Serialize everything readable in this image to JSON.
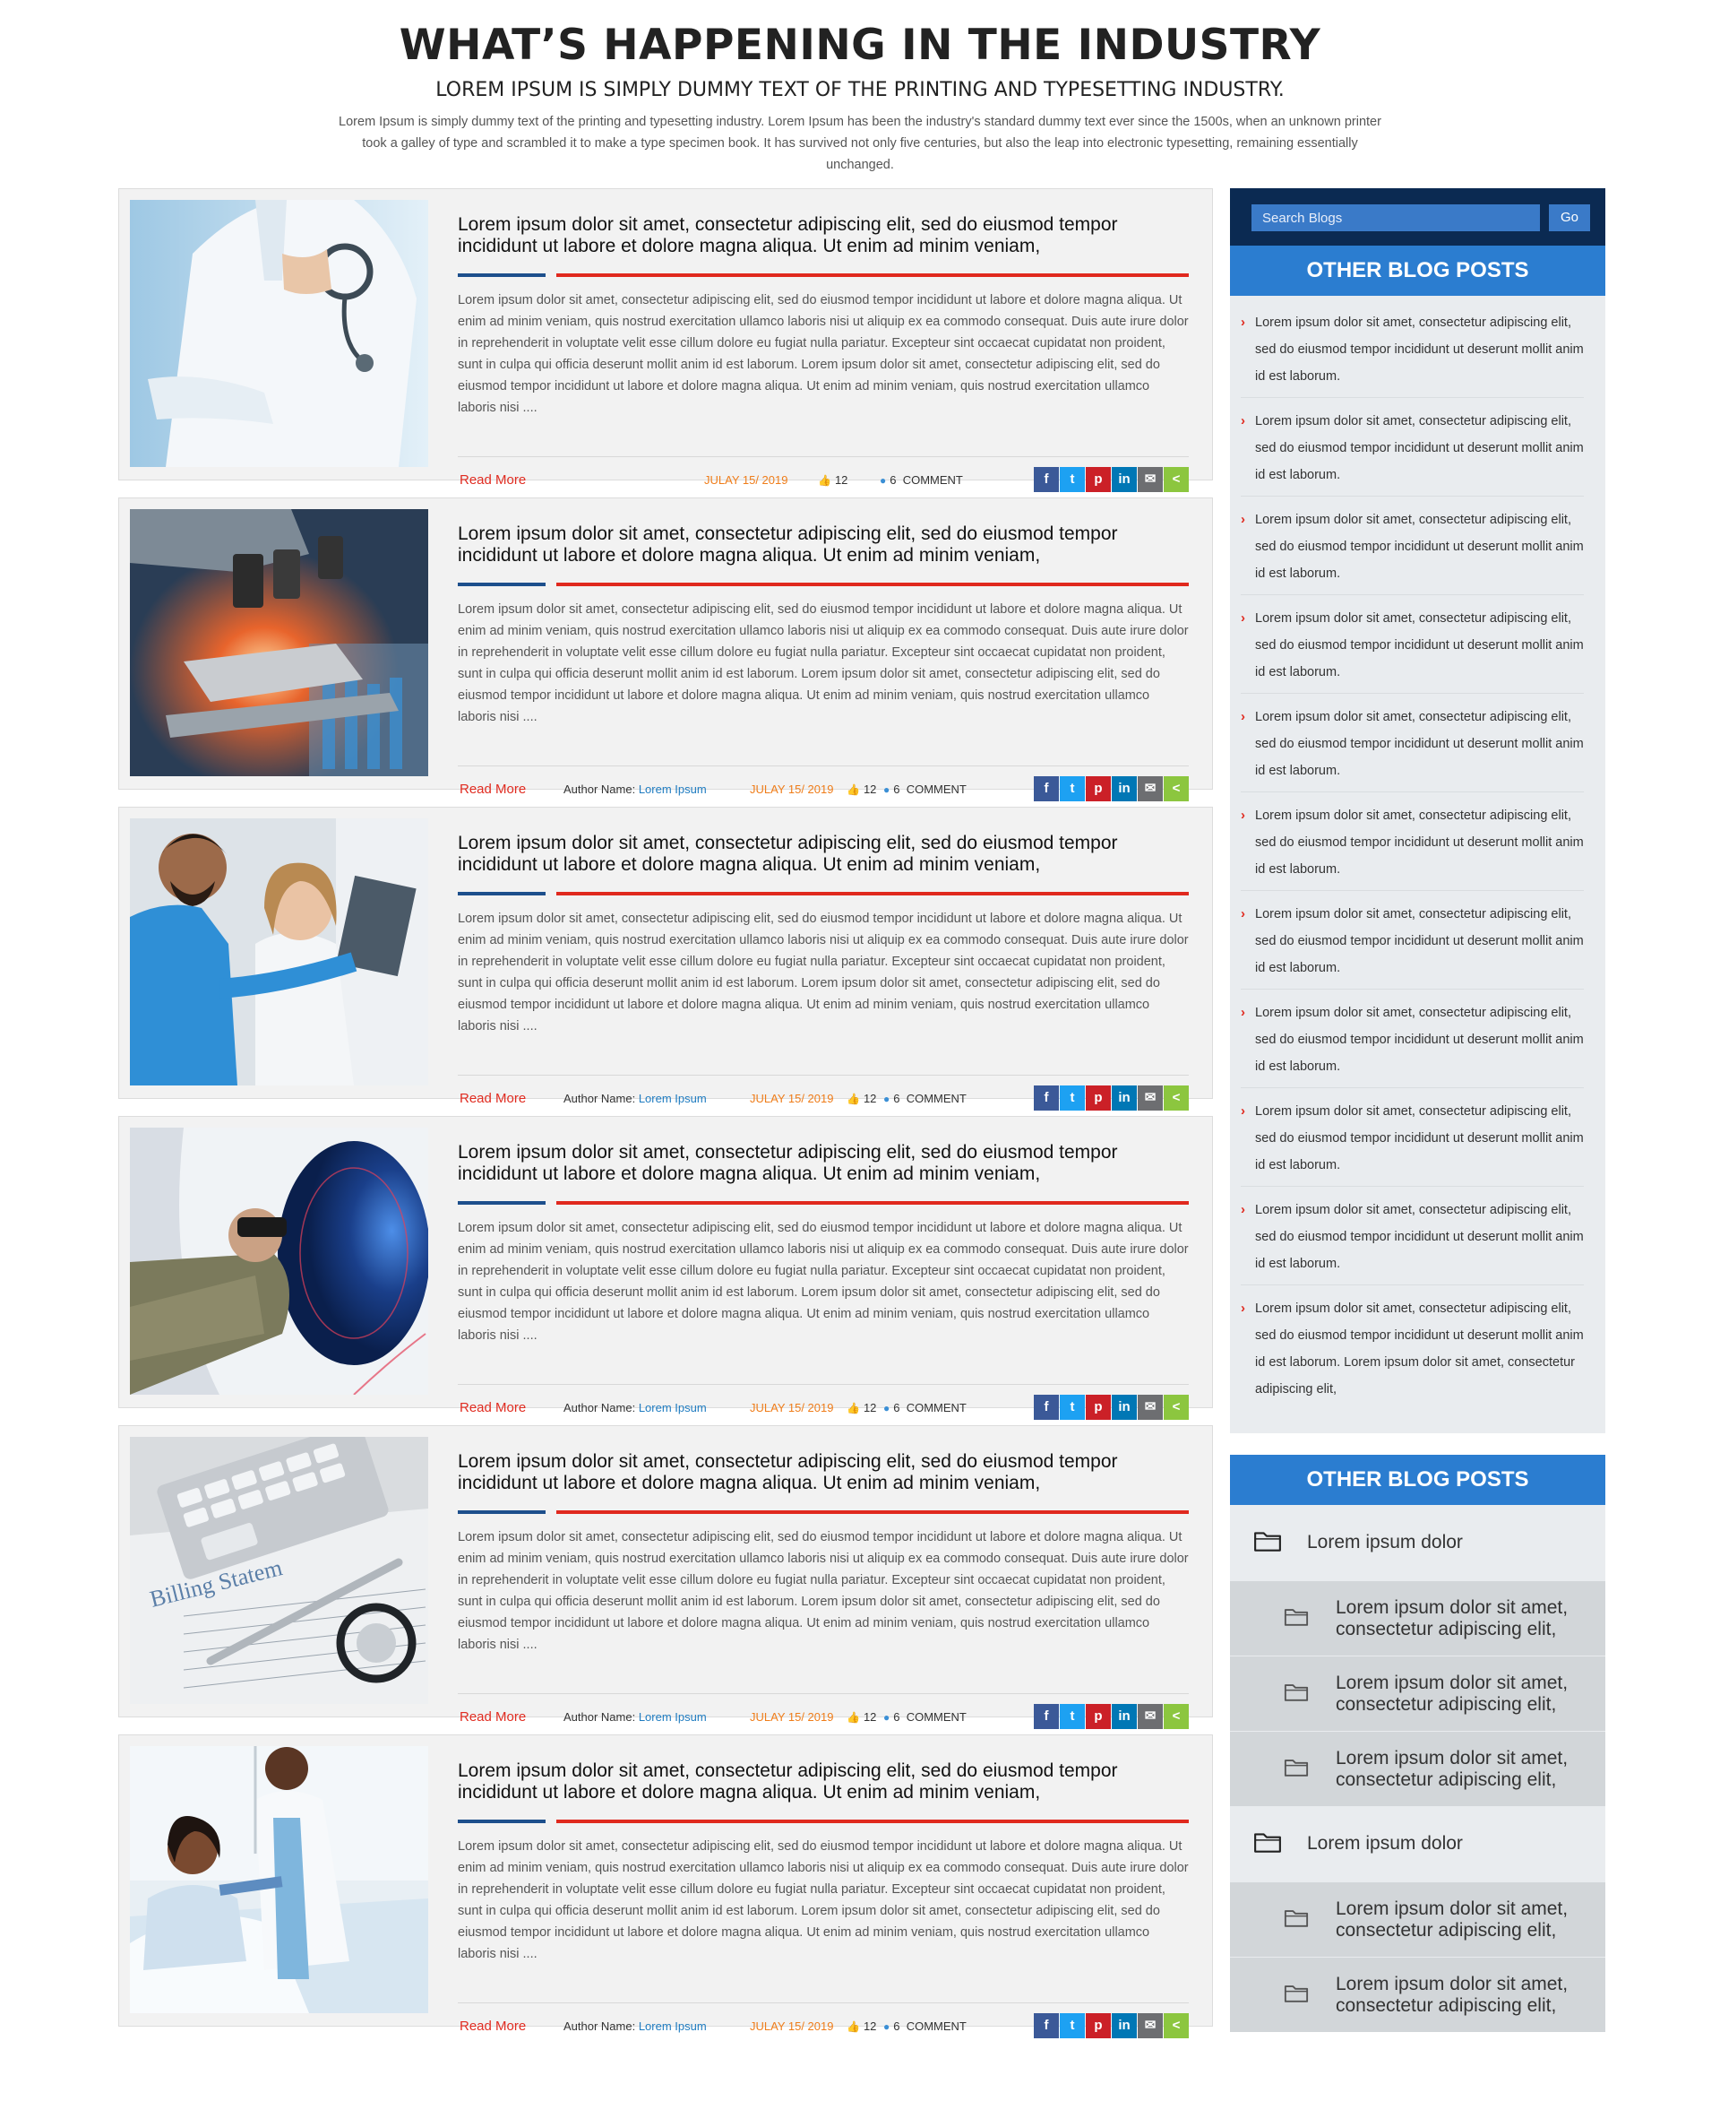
{
  "header": {
    "title": "WHAT’S HAPPENING IN THE INDUSTRY",
    "subtitle": "LOREM IPSUM IS SIMPLY DUMMY TEXT OF THE PRINTING AND TYPESETTING INDUSTRY.",
    "intro": "Lorem Ipsum is simply dummy text of the printing and typesetting industry. Lorem Ipsum has been the industry's standard dummy text ever since the 1500s, when an unknown printer took a galley of type and scrambled it to make a type specimen book. It has survived not only five centuries, but also the leap into electronic typesetting, remaining essentially unchanged."
  },
  "posts": [
    {
      "image": "doctor-with-stethoscope",
      "title": "Lorem ipsum dolor sit amet, consectetur adipiscing elit, sed do eiusmod tempor incididunt ut labore et dolore magna aliqua. Ut enim ad minim veniam,",
      "excerpt": "Lorem ipsum dolor sit amet, consectetur adipiscing elit, sed do eiusmod tempor incididunt ut labore et dolore magna aliqua. Ut enim ad minim veniam, quis nostrud exercitation ullamco laboris nisi ut aliquip ex ea commodo consequat. Duis aute irure dolor in reprehenderit in voluptate velit esse cillum dolore eu fugiat nulla pariatur. Excepteur sint occaecat cupidatat non proident, sunt in culpa qui officia deserunt mollit anim id est laborum. Lorem ipsum dolor sit amet, consectetur adipiscing elit, sed do eiusmod tempor incididunt ut labore et dolore magna aliqua. Ut enim ad minim veniam, quis nostrud exercitation ullamco laboris nisi ....",
      "read_more": "Read More",
      "author_label": "",
      "author_name": "",
      "date": "JULAY 15/ 2019",
      "likes": "12",
      "comments": "6",
      "comments_label": "COMMENT"
    },
    {
      "image": "microscope-lab",
      "title": "Lorem ipsum dolor sit amet, consectetur adipiscing elit, sed do eiusmod tempor incididunt ut labore et dolore magna aliqua. Ut enim ad minim veniam,",
      "excerpt": "Lorem ipsum dolor sit amet, consectetur adipiscing elit, sed do eiusmod tempor incididunt ut labore et dolore magna aliqua. Ut enim ad minim veniam, quis nostrud exercitation ullamco laboris nisi ut aliquip ex ea commodo consequat. Duis aute irure dolor in reprehenderit in voluptate velit esse cillum dolore eu fugiat nulla pariatur. Excepteur sint occaecat cupidatat non proident, sunt in culpa qui officia deserunt mollit anim id est laborum. Lorem ipsum dolor sit amet, consectetur adipiscing elit, sed do eiusmod tempor incididunt ut labore et dolore magna aliqua. Ut enim ad minim veniam, quis nostrud exercitation ullamco laboris nisi ....",
      "read_more": "Read More",
      "author_label": "Author Name:",
      "author_name": "Lorem Ipsum",
      "date": "JULAY 15/ 2019",
      "likes": "12",
      "comments": "6",
      "comments_label": "COMMENT"
    },
    {
      "image": "doctors-reviewing-xray",
      "title": "Lorem ipsum dolor sit amet, consectetur adipiscing elit, sed do eiusmod tempor incididunt ut labore et dolore magna aliqua. Ut enim ad minim veniam,",
      "excerpt": "Lorem ipsum dolor sit amet, consectetur adipiscing elit, sed do eiusmod tempor incididunt ut labore et dolore magna aliqua. Ut enim ad minim veniam, quis nostrud exercitation ullamco laboris nisi ut aliquip ex ea commodo consequat. Duis aute irure dolor in reprehenderit in voluptate velit esse cillum dolore eu fugiat nulla pariatur. Excepteur sint occaecat cupidatat non proident, sunt in culpa qui officia deserunt mollit anim id est laborum. Lorem ipsum dolor sit amet, consectetur adipiscing elit, sed do eiusmod tempor incididunt ut labore et dolore magna aliqua. Ut enim ad minim veniam, quis nostrud exercitation ullamco laboris nisi ....",
      "read_more": "Read More",
      "author_label": "Author Name:",
      "author_name": "Lorem Ipsum",
      "date": "JULAY 15/ 2019",
      "likes": "12",
      "comments": "6",
      "comments_label": "COMMENT"
    },
    {
      "image": "patient-in-mri-scanner",
      "title": "Lorem ipsum dolor sit amet, consectetur adipiscing elit, sed do eiusmod tempor incididunt ut labore et dolore magna aliqua. Ut enim ad minim veniam,",
      "excerpt": "Lorem ipsum dolor sit amet, consectetur adipiscing elit, sed do eiusmod tempor incididunt ut labore et dolore magna aliqua. Ut enim ad minim veniam, quis nostrud exercitation ullamco laboris nisi ut aliquip ex ea commodo consequat. Duis aute irure dolor in reprehenderit in voluptate velit esse cillum dolore eu fugiat nulla pariatur. Excepteur sint occaecat cupidatat non proident, sunt in culpa qui officia deserunt mollit anim id est laborum. Lorem ipsum dolor sit amet, consectetur adipiscing elit, sed do eiusmod tempor incididunt ut labore et dolore magna aliqua. Ut enim ad minim veniam, quis nostrud exercitation ullamco laboris nisi ....",
      "read_more": "Read More",
      "author_label": "Author Name:",
      "author_name": "Lorem Ipsum",
      "date": "JULAY 15/ 2019",
      "likes": "12",
      "comments": "6",
      "comments_label": "COMMENT"
    },
    {
      "image": "billing-statement-calculator",
      "image_caption": "Billing Statem",
      "title": "Lorem ipsum dolor sit amet, consectetur adipiscing elit, sed do eiusmod tempor incididunt ut labore et dolore magna aliqua. Ut enim ad minim veniam,",
      "excerpt": "Lorem ipsum dolor sit amet, consectetur adipiscing elit, sed do eiusmod tempor incididunt ut labore et dolore magna aliqua. Ut enim ad minim veniam, quis nostrud exercitation ullamco laboris nisi ut aliquip ex ea commodo consequat. Duis aute irure dolor in reprehenderit in voluptate velit esse cillum dolore eu fugiat nulla pariatur. Excepteur sint occaecat cupidatat non proident, sunt in culpa qui officia deserunt mollit anim id est laborum. Lorem ipsum dolor sit amet, consectetur adipiscing elit, sed do eiusmod tempor incididunt ut labore et dolore magna aliqua. Ut enim ad minim veniam, quis nostrud exercitation ullamco laboris nisi ....",
      "read_more": "Read More",
      "author_label": "Author Name:",
      "author_name": "Lorem Ipsum",
      "date": "JULAY 15/ 2019",
      "likes": "12",
      "comments": "6",
      "comments_label": "COMMENT"
    },
    {
      "image": "doctor-with-patient-in-bed",
      "title": "Lorem ipsum dolor sit amet, consectetur adipiscing elit, sed do eiusmod tempor incididunt ut labore et dolore magna aliqua. Ut enim ad minim veniam,",
      "excerpt": "Lorem ipsum dolor sit amet, consectetur adipiscing elit, sed do eiusmod tempor incididunt ut labore et dolore magna aliqua. Ut enim ad minim veniam, quis nostrud exercitation ullamco laboris nisi ut aliquip ex ea commodo consequat. Duis aute irure dolor in reprehenderit in voluptate velit esse cillum dolore eu fugiat nulla pariatur. Excepteur sint occaecat cupidatat non proident, sunt in culpa qui officia deserunt mollit anim id est laborum. Lorem ipsum dolor sit amet, consectetur adipiscing elit, sed do eiusmod tempor incididunt ut labore et dolore magna aliqua. Ut enim ad minim veniam, quis nostrud exercitation ullamco laboris nisi ....",
      "read_more": "Read More",
      "author_label": "Author Name:",
      "author_name": "Lorem Ipsum",
      "date": "JULAY 15/ 2019",
      "likes": "12",
      "comments": "6",
      "comments_label": "COMMENT"
    }
  ],
  "share_buttons": [
    {
      "icon": "facebook-icon",
      "glyph": "f",
      "color": "#3b5998"
    },
    {
      "icon": "twitter-icon",
      "glyph": "t",
      "color": "#1da1f2"
    },
    {
      "icon": "pinterest-icon",
      "glyph": "p",
      "color": "#cb2027"
    },
    {
      "icon": "linkedin-icon",
      "glyph": "in",
      "color": "#0077b5"
    },
    {
      "icon": "email-icon",
      "glyph": "✉",
      "color": "#6d6e71"
    },
    {
      "icon": "share-icon",
      "glyph": "<",
      "color": "#8cc63f"
    }
  ],
  "sidebar": {
    "search_placeholder": "Search Blogs",
    "search_button": "Go",
    "recent_title": "OTHER BLOG POSTS",
    "recent_posts": [
      "Lorem ipsum dolor sit amet, consectetur adipiscing elit, sed do eiusmod tempor incididunt ut deserunt mollit anim id est laborum.",
      "Lorem ipsum dolor sit amet, consectetur adipiscing elit, sed do eiusmod tempor incididunt ut deserunt mollit anim id est laborum.",
      "Lorem ipsum dolor sit amet, consectetur adipiscing elit, sed do eiusmod tempor incididunt ut deserunt mollit anim id est laborum.",
      "Lorem ipsum dolor sit amet, consectetur adipiscing elit, sed do eiusmod tempor incididunt ut deserunt mollit anim id est laborum.",
      "Lorem ipsum dolor sit amet, consectetur adipiscing elit, sed do eiusmod tempor incididunt ut deserunt mollit anim id est laborum.",
      "Lorem ipsum dolor sit amet, consectetur adipiscing elit, sed do eiusmod tempor incididunt ut deserunt mollit anim id est laborum.",
      "Lorem ipsum dolor sit amet, consectetur adipiscing elit, sed do eiusmod tempor incididunt ut deserunt mollit anim id est laborum.",
      "Lorem ipsum dolor sit amet, consectetur adipiscing elit, sed do eiusmod tempor incididunt ut deserunt mollit anim id est laborum.",
      "Lorem ipsum dolor sit amet, consectetur adipiscing elit, sed do eiusmod tempor incididunt ut deserunt mollit anim id est laborum.",
      "Lorem ipsum dolor sit amet, consectetur adipiscing elit, sed do eiusmod tempor incididunt ut deserunt mollit anim id est laborum.",
      "Lorem ipsum dolor sit amet, consectetur adipiscing elit, sed do eiusmod tempor incididunt ut deserunt mollit anim id est laborum. Lorem ipsum dolor sit amet, consectetur adipiscing elit,"
    ],
    "categories_title": "OTHER BLOG POSTS",
    "categories": [
      {
        "label": "Lorem ipsum dolor",
        "children": [
          "Lorem ipsum dolor sit amet, consectetur adipiscing elit,",
          "Lorem ipsum dolor sit amet, consectetur adipiscing elit,",
          "Lorem ipsum dolor sit amet, consectetur adipiscing elit,"
        ]
      },
      {
        "label": "Lorem ipsum dolor",
        "children": [
          "Lorem ipsum dolor sit amet, consectetur adipiscing elit,",
          "Lorem ipsum dolor sit amet, consectetur adipiscing elit,"
        ]
      }
    ]
  },
  "colors": {
    "accent_blue": "#2b7dd0",
    "navy": "#0b2a52",
    "rule_blue": "#1d4f8c",
    "rule_red": "#e0291e",
    "date_orange": "#ef7d1a",
    "read_more_red": "#e02b20"
  }
}
